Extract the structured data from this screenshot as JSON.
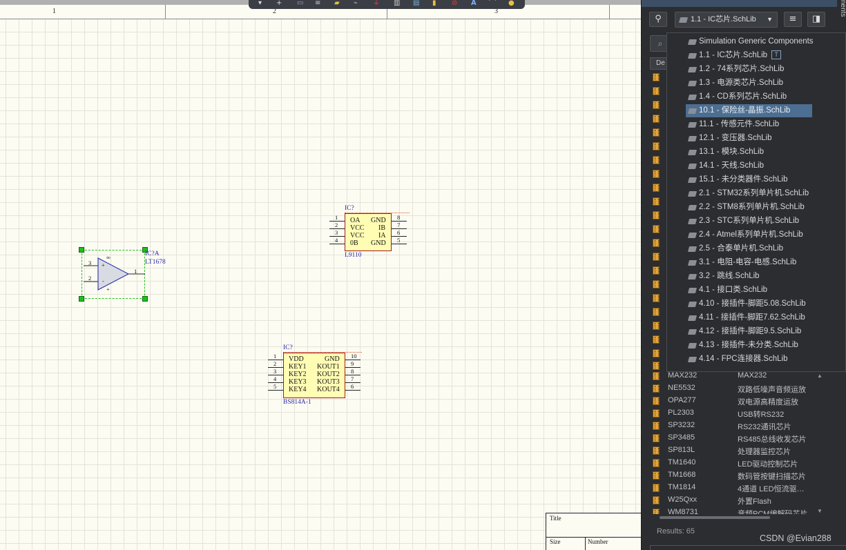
{
  "ruler": {
    "col1": "1",
    "col2": "2",
    "col3": "3"
  },
  "components": {
    "opamp": {
      "designator": "IC?A",
      "value": "LT1678",
      "pin_in_plus": "3",
      "pin_in_minus": "2",
      "pin_out": "1",
      "sym_plus": "+",
      "sym_minus": "-",
      "sym_inf": "∞"
    },
    "l9110": {
      "designator": "IC?",
      "value": "L9110",
      "left_pins": [
        {
          "num": "1",
          "name": "OA"
        },
        {
          "num": "2",
          "name": "VCC"
        },
        {
          "num": "3",
          "name": "VCC"
        },
        {
          "num": "4",
          "name": "0B"
        }
      ],
      "right_pins": [
        {
          "num": "8",
          "name": "GND"
        },
        {
          "num": "7",
          "name": "IB"
        },
        {
          "num": "6",
          "name": "IA"
        },
        {
          "num": "5",
          "name": "GND"
        }
      ]
    },
    "bs814": {
      "designator": "IC?",
      "value": "BS814A-1",
      "left_pins": [
        {
          "num": "1",
          "name": "VDD"
        },
        {
          "num": "2",
          "name": "KEY1"
        },
        {
          "num": "3",
          "name": "KEY2"
        },
        {
          "num": "4",
          "name": "KEY3"
        },
        {
          "num": "5",
          "name": "KEY4"
        }
      ],
      "right_pins": [
        {
          "num": "10",
          "name": "GND"
        },
        {
          "num": "9",
          "name": "KOUT1"
        },
        {
          "num": "8",
          "name": "KOUT2"
        },
        {
          "num": "7",
          "name": "KOUT3"
        },
        {
          "num": "6",
          "name": "KOUT4"
        }
      ]
    }
  },
  "title_block": {
    "title": "Title",
    "size": "Size",
    "number": "Number"
  },
  "panel": {
    "vertical_tab": "nents",
    "library_combo": "1.1   - IC芯片.SchLib",
    "column_header": "De",
    "results": "Results: 65"
  },
  "dropdown": {
    "items": [
      "Simulation Generic Components",
      "1.1   - IC芯片.SchLib",
      "1.2   - 74系列芯片.SchLib",
      "1.3   - 电源类芯片.SchLib",
      "1.4   - CD系列芯片.SchLib",
      "10.1 - 保险丝-晶振.SchLib",
      "11.1 - 传感元件.SchLib",
      "12.1 - 变压器.SchLib",
      "13.1 - 模块.SchLib",
      "14.1 - 天线.SchLib",
      "15.1 - 未分类器件.SchLib",
      "2.1   - STM32系列单片机.SchLib",
      "2.2   - STM8系列单片机.SchLib",
      "2.3   - STC系列单片机.SchLib",
      "2.4   - Atmel系列单片机.SchLib",
      "2.5   - 合泰单片机.SchLib",
      "3.1   - 电阻-电容-电感.SchLib",
      "3.2   - 跳线.SchLib",
      "4.1   - 接口类.SchLib",
      "4.10 - 接插件-脚距5.08.SchLib",
      "4.11 - 接插件-脚距7.62.SchLib",
      "4.12 - 接插件-脚距9.5.SchLib",
      "4.13 - 接插件-未分类.SchLib",
      "4.14 - FPC连接器.SchLib"
    ],
    "badge": "T"
  },
  "parts": [
    {
      "name": "MAX232",
      "desc": "MAX232"
    },
    {
      "name": "NE5532",
      "desc": "双路低噪声音频运放"
    },
    {
      "name": "OPA277",
      "desc": "双电源高精度运放"
    },
    {
      "name": "PL2303",
      "desc": "USB转RS232"
    },
    {
      "name": "SP3232",
      "desc": "RS232通讯芯片"
    },
    {
      "name": "SP3485",
      "desc": "RS485总线收发芯片"
    },
    {
      "name": "SP813L",
      "desc": "处理器监控芯片"
    },
    {
      "name": "TM1640",
      "desc": "LED驱动控制芯片"
    },
    {
      "name": "TM1668",
      "desc": "数码管按键扫描芯片"
    },
    {
      "name": "TM1814",
      "desc": "4通道 LED恒流驱动..."
    },
    {
      "name": "W25Qxx",
      "desc": "外置Flash"
    },
    {
      "name": "WM8731",
      "desc": "音频PCM编解码芯片"
    }
  ],
  "watermark": "CSDN @Evian288"
}
